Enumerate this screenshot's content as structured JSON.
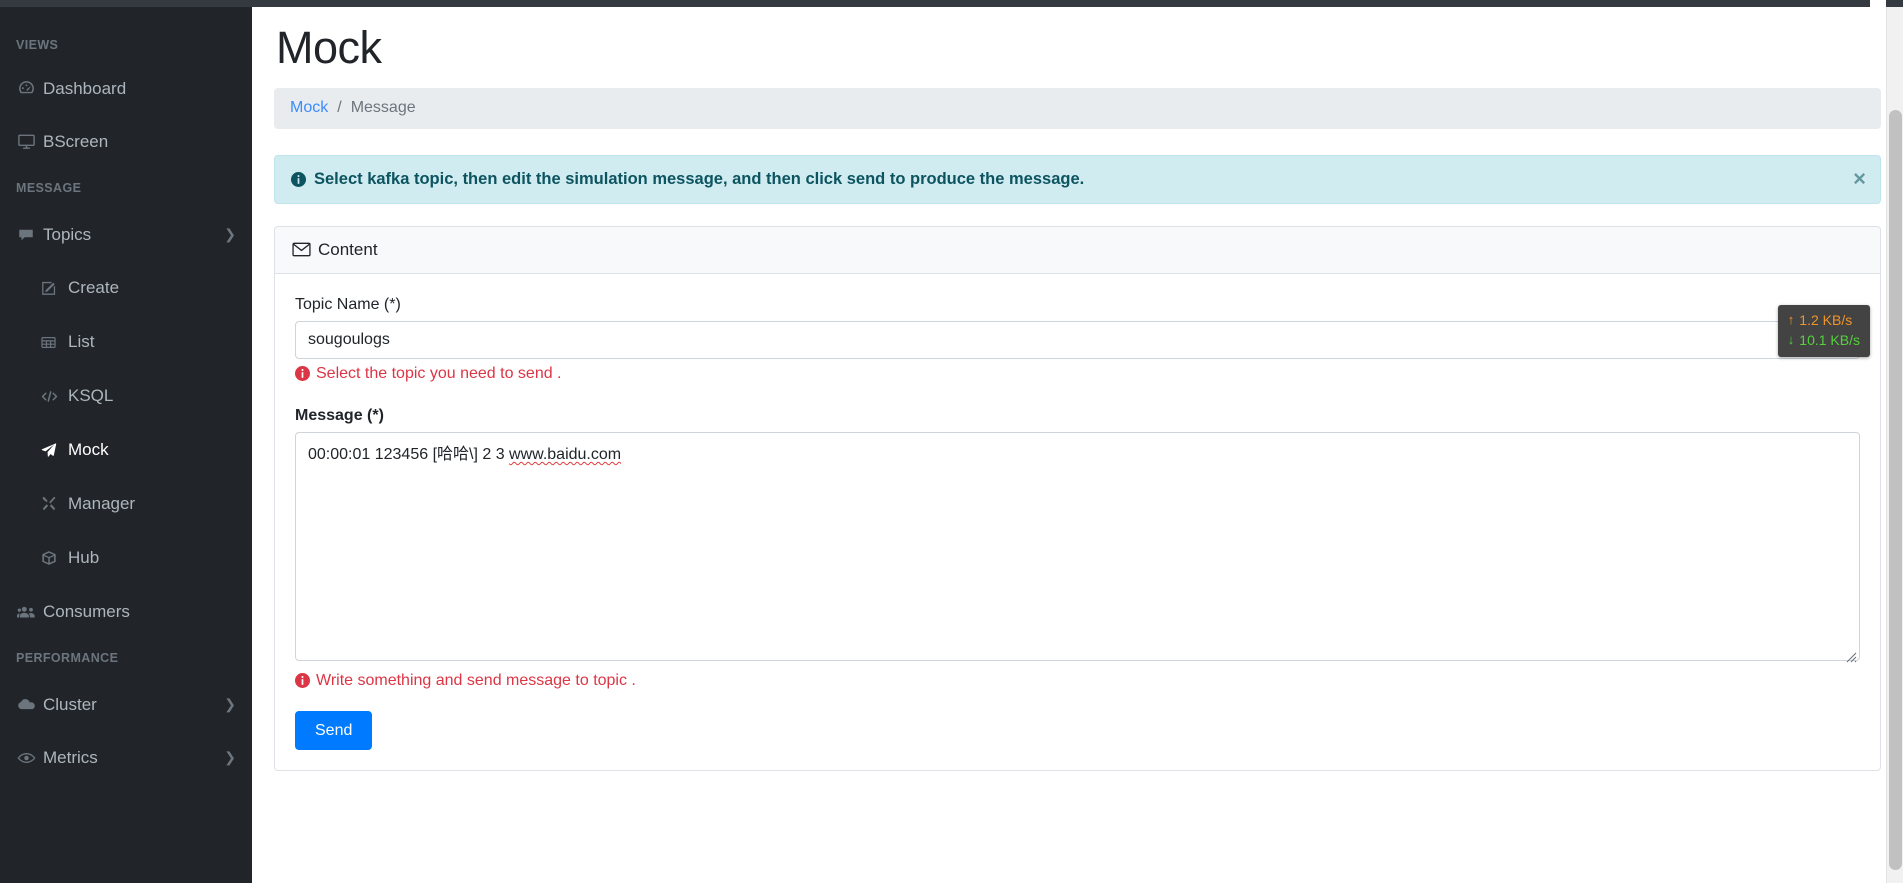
{
  "sidebar": {
    "sections": [
      {
        "title": "VIEWS",
        "items": [
          {
            "label": "Dashboard",
            "icon": "gauge-icon",
            "chevron": ""
          },
          {
            "label": "BScreen",
            "icon": "monitor-icon",
            "chevron": ""
          }
        ]
      },
      {
        "title": "MESSAGE",
        "items": [
          {
            "label": "Topics",
            "icon": "comment-icon",
            "chevron": "❯"
          },
          {
            "label": "Create",
            "icon": "edit-icon",
            "chevron": ""
          },
          {
            "label": "List",
            "icon": "table-icon",
            "chevron": ""
          },
          {
            "label": "KSQL",
            "icon": "code-icon",
            "chevron": ""
          },
          {
            "label": "Mock",
            "icon": "paper-plane-icon",
            "chevron": ""
          },
          {
            "label": "Manager",
            "icon": "tools-icon",
            "chevron": ""
          },
          {
            "label": "Hub",
            "icon": "cube-icon",
            "chevron": ""
          },
          {
            "label": "Consumers",
            "icon": "users-icon",
            "chevron": ""
          }
        ]
      },
      {
        "title": "PERFORMANCE",
        "items": [
          {
            "label": "Cluster",
            "icon": "cloud-icon",
            "chevron": "❯"
          },
          {
            "label": "Metrics",
            "icon": "eye-icon",
            "chevron": "❯"
          }
        ]
      }
    ],
    "active_item": "Mock"
  },
  "page": {
    "title": "Mock",
    "breadcrumb": {
      "root": "Mock",
      "separator": "/",
      "current": "Message"
    }
  },
  "alert": {
    "icon": "info-circle-icon",
    "text": "Select kafka topic, then edit the simulation message, and then click send to produce the message.",
    "close_label": "×",
    "background": "#d1ecf1",
    "text_color": "#0c5460"
  },
  "card": {
    "icon": "envelope-icon",
    "title": "Content",
    "topic": {
      "label": "Topic Name (*)",
      "value": "sougoulogs",
      "options": [
        "sougoulogs"
      ],
      "help_icon": "info-circle-icon",
      "help_text": "Select the topic you need to send .",
      "help_color": "#dc3545"
    },
    "message": {
      "label": "Message (*)",
      "value_prefix": "00:00:01 123456 [哈哈\\] 2 3 ",
      "value_link": "www.baidu.com",
      "placeholder": "",
      "help_icon": "info-circle-icon",
      "help_text": "Write something and send message to topic .",
      "help_color": "#dc3545"
    },
    "send_label": "Send",
    "send_color": "#007bff"
  },
  "net_speed": {
    "upload_arrow": "↑",
    "upload": "1.2 KB/s",
    "download_arrow": "↓",
    "download": "10.1 KB/s",
    "upload_color": "#f0932b",
    "download_color": "#53d23a",
    "background": "#434343"
  }
}
